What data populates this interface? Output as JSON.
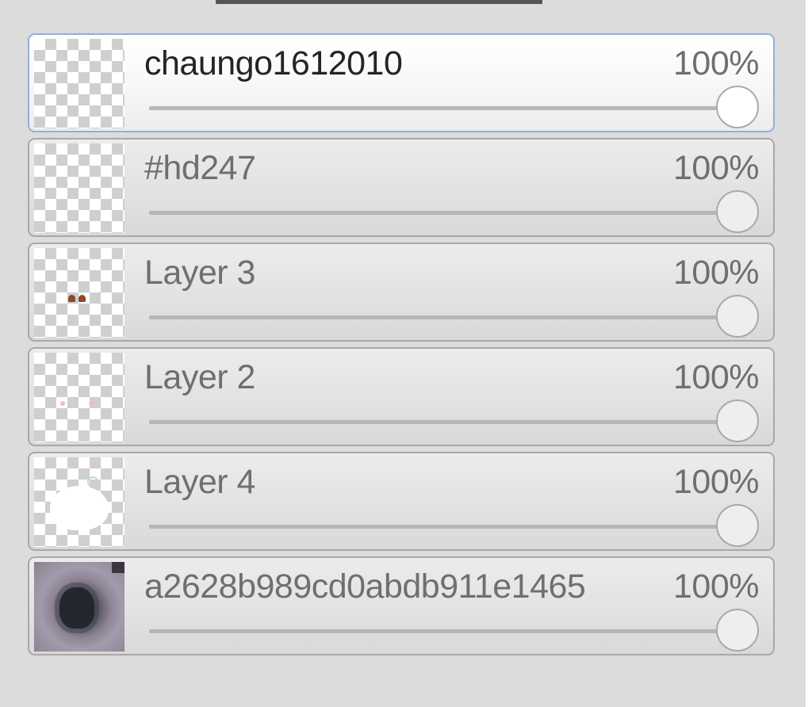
{
  "layers_panel": {
    "layers": [
      {
        "name": "chaungo1612010",
        "opacity_label": "100%",
        "opacity_value": 100,
        "selected": true,
        "thumbnail": "transparent-checker"
      },
      {
        "name": "#hd247",
        "opacity_label": "100%",
        "opacity_value": 100,
        "selected": false,
        "thumbnail": "transparent-checker"
      },
      {
        "name": "Layer 3",
        "opacity_label": "100%",
        "opacity_value": 100,
        "selected": false,
        "thumbnail": "brown-marks-on-checker"
      },
      {
        "name": "Layer 2",
        "opacity_label": "100%",
        "opacity_value": 100,
        "selected": false,
        "thumbnail": "pink-marks-on-checker"
      },
      {
        "name": "Layer 4",
        "opacity_label": "100%",
        "opacity_value": 100,
        "selected": false,
        "thumbnail": "white-shape-on-checker"
      },
      {
        "name": "a2628b989cd0abdb911e1465",
        "opacity_label": "100%",
        "opacity_value": 100,
        "selected": false,
        "thumbnail": "photo"
      }
    ]
  },
  "colors": {
    "panel_background": "#dcdcdc",
    "selected_border": "#8eb0de",
    "layer_border": "#a8a8a8",
    "selected_text": "#242424",
    "text": "#6f6f6f",
    "slider_track": "#b6b6b6"
  }
}
